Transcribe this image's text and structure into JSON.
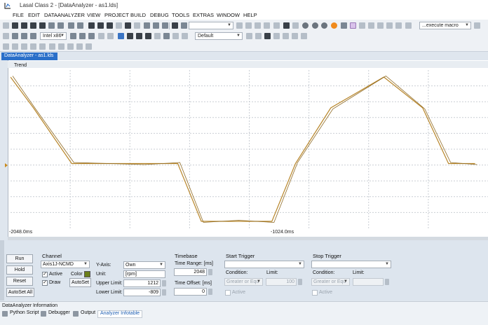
{
  "window": {
    "title": "Lasal Class 2 - [DataAnalyzer - as1.lds]"
  },
  "menu": [
    "FILE",
    "EDIT",
    "DATAANALYZER",
    "VIEW",
    "PROJECT",
    "BUILD",
    "DEBUG",
    "TOOLS",
    "EXTRAS",
    "WINDOW",
    "HELP"
  ],
  "toolbar": {
    "platform_select": "Intel x86",
    "layout_select": "Default",
    "macro_select": "...execute macro"
  },
  "document_tab": {
    "label": "DataAnalyzer - as1.lds"
  },
  "trend": {
    "title": "Trend",
    "x_start_label": "-2048.0ms",
    "x_mid_label": "-1024.0ms",
    "trace_color": "#b8862a"
  },
  "chart_data": {
    "type": "line",
    "x": [
      -2048,
      -1970,
      -1840,
      -1600,
      -1480,
      -1400,
      -1280,
      -1160,
      -1080,
      -960,
      -780,
      -648,
      -560,
      -470
    ],
    "series": [
      {
        "values": [
          1212,
          780,
          0,
          0,
          0,
          -809,
          -809,
          -809,
          0,
          780,
          1212,
          780,
          0,
          0
        ]
      }
    ],
    "xlabel": "",
    "ylabel": "",
    "grid": true
  },
  "buttons": {
    "run": "Run",
    "hold": "Hold",
    "reset": "Reset",
    "autoset_all": "AutoSet All",
    "autoset": "AutoSet"
  },
  "channel": {
    "title": "Channel",
    "name": "Axis1J-NCMD",
    "active_label": "Active",
    "active_checked": "✓",
    "draw_label": "Draw",
    "draw_checked": "✓",
    "color_label": "Color",
    "color_value": "#6b7f1a"
  },
  "yaxis": {
    "label": "Y-Axis:",
    "mode": "Own",
    "unit_label": "Unit:",
    "unit_value": "[rpm]",
    "upper_label": "Upper Limit:",
    "upper_value": "1212",
    "lower_label": "Lower Limit:",
    "lower_value": "-809"
  },
  "timebase": {
    "title": "Timebase",
    "range_label": "Time Range: [ms]",
    "range_value": "2048",
    "offset_label": "Time Offset: [ms]",
    "offset_value": "0"
  },
  "start_trigger": {
    "title": "Start Trigger",
    "condition_label": "Condition:",
    "condition_value": "Greater or Equ",
    "limit_label": "Limit:",
    "limit_value": "100",
    "active_label": "Active"
  },
  "stop_trigger": {
    "title": "Stop Trigger",
    "condition_label": "Condition:",
    "condition_value": "Greater or Equ",
    "limit_label": "Limit:",
    "active_label": "Active"
  },
  "status": {
    "text": "DataAnalyzer Information"
  },
  "bottom_tabs": [
    "Python Script",
    "Debugger",
    "Output",
    "Analyzer Infotable"
  ]
}
